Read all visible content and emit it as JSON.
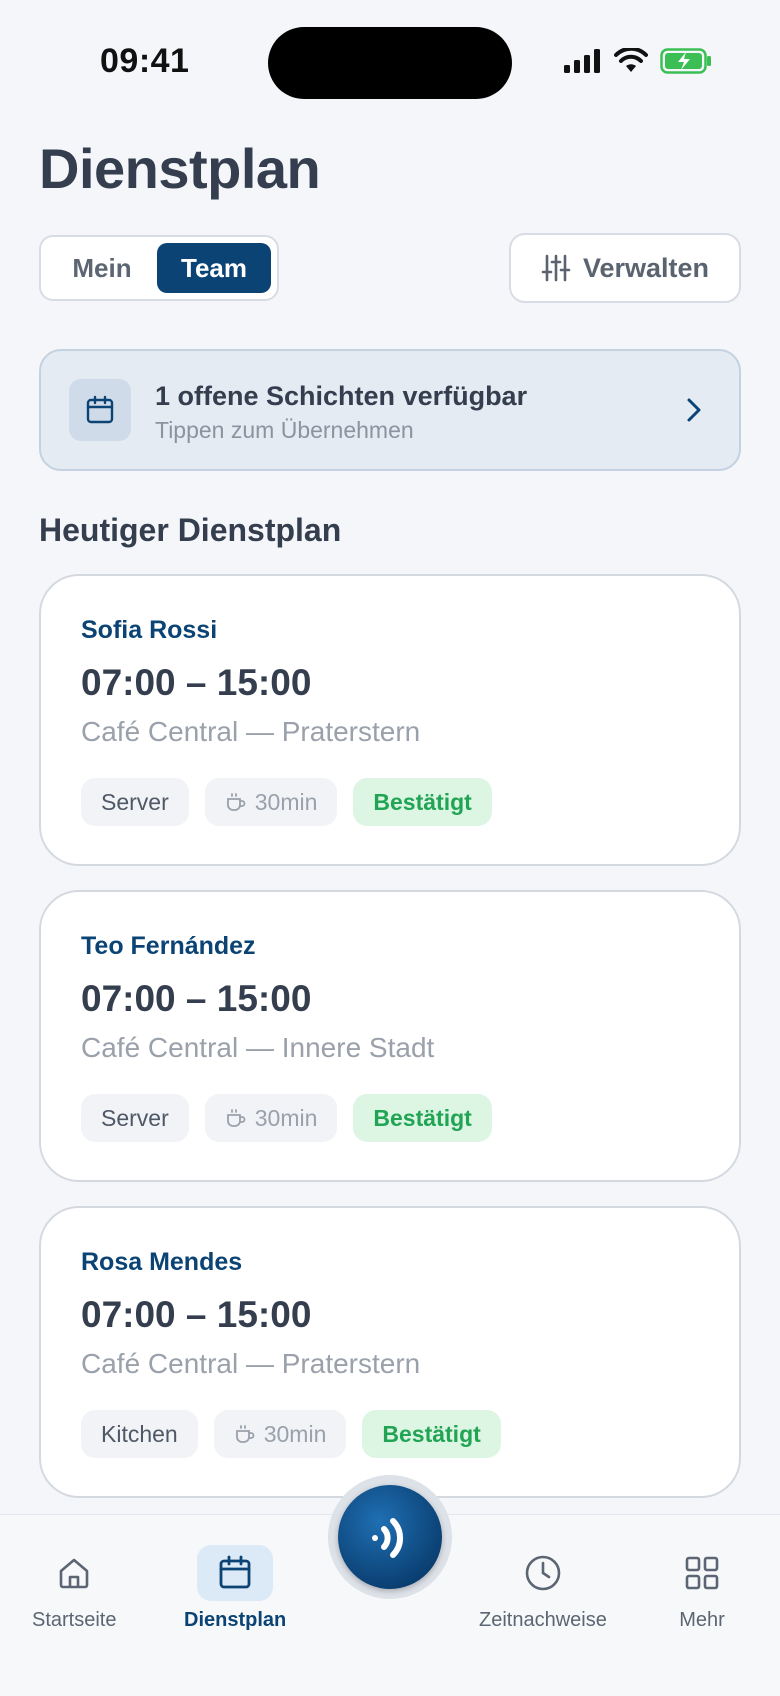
{
  "status_bar": {
    "time": "09:41"
  },
  "header": {
    "title": "Dienstplan"
  },
  "view_toggle": {
    "mine_label": "Mein",
    "team_label": "Team",
    "selected": "Team"
  },
  "manage_button": {
    "label": "Verwalten"
  },
  "open_shifts_banner": {
    "title": "1 offene Schichten verfügbar",
    "subtitle": "Tippen zum Übernehmen"
  },
  "section": {
    "title": "Heutiger Dienstplan"
  },
  "shifts": [
    {
      "name": "Sofia Rossi",
      "time": "07:00 – 15:00",
      "location": "Café Central — Praterstern",
      "role": "Server",
      "break": "30min",
      "status": "Bestätigt"
    },
    {
      "name": "Teo Fernández",
      "time": "07:00 – 15:00",
      "location": "Café Central — Innere Stadt",
      "role": "Server",
      "break": "30min",
      "status": "Bestätigt"
    },
    {
      "name": "Rosa Mendes",
      "time": "07:00 – 15:00",
      "location": "Café Central — Praterstern",
      "role": "Kitchen",
      "break": "30min",
      "status": "Bestätigt"
    }
  ],
  "tab_bar": {
    "items": [
      {
        "label": "Startseite",
        "icon": "home-icon"
      },
      {
        "label": "Dienstplan",
        "icon": "calendar-icon",
        "active": true
      },
      {
        "label": "Zeitnachweise",
        "icon": "clock-icon"
      },
      {
        "label": "Mehr",
        "icon": "grid-icon"
      }
    ],
    "center_action_icon": "nfc-icon"
  },
  "colors": {
    "primary": "#0b4474",
    "success": "#22a455",
    "success_bg": "#dcf6e3",
    "background": "#f4f6fa"
  }
}
